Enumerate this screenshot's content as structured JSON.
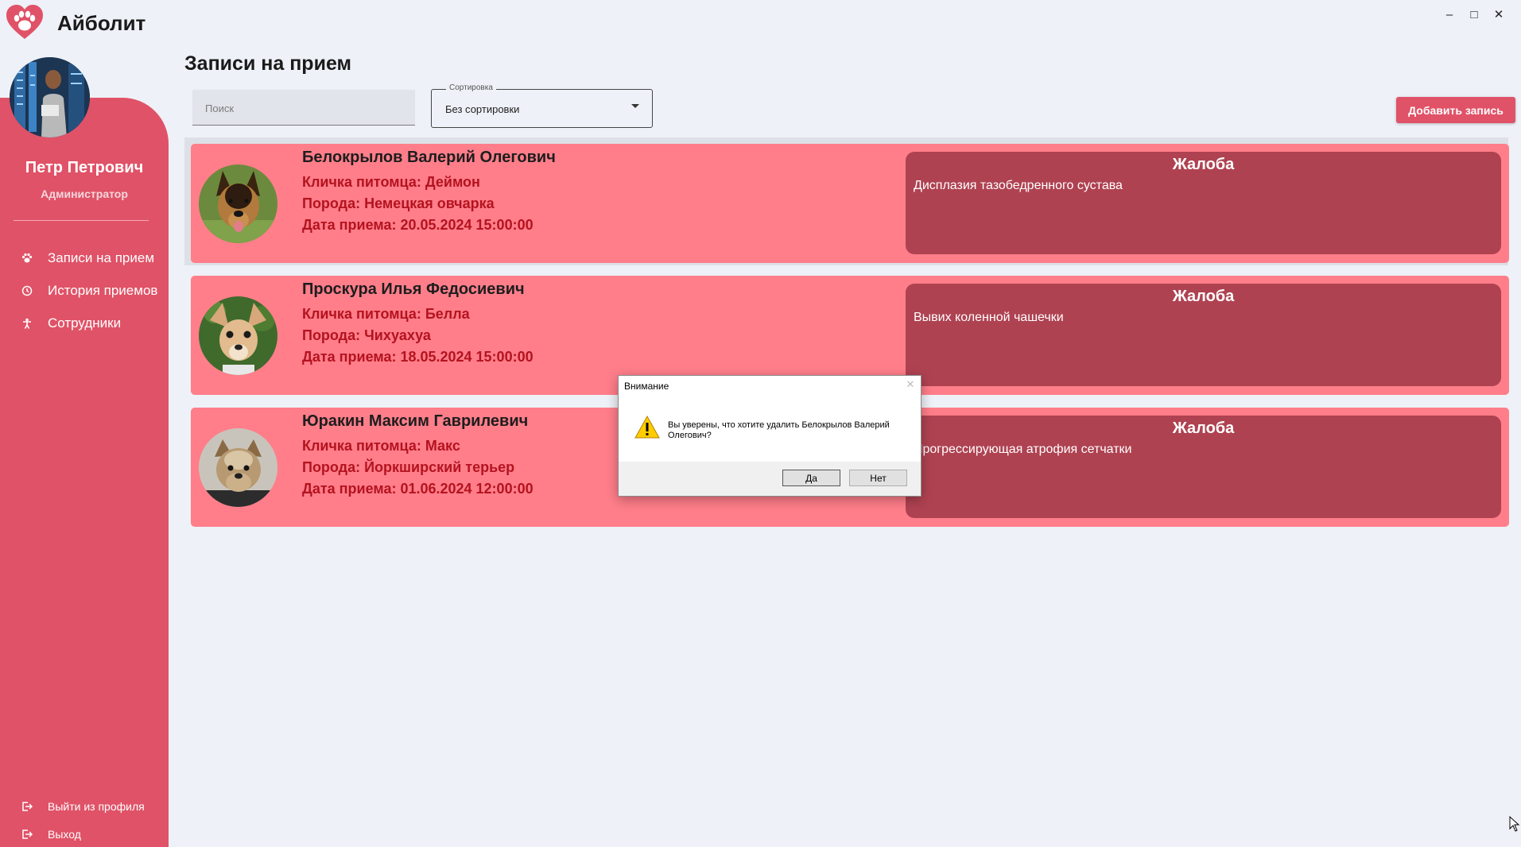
{
  "app": {
    "title": "Айболит",
    "window_controls": {
      "minimize": "–",
      "maximize": "□",
      "close": "✕"
    },
    "logo_icon": "paw-heart-logo-icon",
    "brand_color": "#e05267"
  },
  "sidebar": {
    "user_name": "Петр Петрович",
    "user_role": "Администратор",
    "nav": [
      {
        "label": "Записи на прием",
        "icon": "paw-icon"
      },
      {
        "label": "История приемов",
        "icon": "history-icon"
      },
      {
        "label": "Сотрудники",
        "icon": "person-icon"
      }
    ],
    "bottom": [
      {
        "label": "Выйти из профиля",
        "icon": "logout-icon"
      },
      {
        "label": "Выход",
        "icon": "exit-icon"
      }
    ]
  },
  "main": {
    "title": "Записи на прием",
    "search_placeholder": "Поиск",
    "sort_label": "Сортировка",
    "sort_value": "Без сортировки",
    "add_button": "Добавить запись"
  },
  "appointments": [
    {
      "owner": "Белокрылов Валерий Олегович",
      "pet_name": "Кличка питомца: Деймон",
      "breed": "Порода: Немецкая овчарка",
      "date": "Дата приема: 20.05.2024 15:00:00",
      "complaint_title": "Жалоба",
      "complaint": "Дисплазия тазобедренного сустава"
    },
    {
      "owner": "Проскура Илья Федосиевич",
      "pet_name": "Кличка питомца: Белла",
      "breed": "Порода: Чихуахуа",
      "date": "Дата приема: 18.05.2024 15:00:00",
      "complaint_title": "Жалоба",
      "complaint": "Вывих коленной чашечки"
    },
    {
      "owner": "Юракин Максим Гаврилевич",
      "pet_name": "Кличка питомца: Макс",
      "breed": "Порода: Йоркширский терьер",
      "date": "Дата приема: 01.06.2024 12:00:00",
      "complaint_title": "Жалоба",
      "complaint": "Прогрессирующая атрофия сетчатки"
    }
  ],
  "dialog": {
    "title": "Внимание",
    "message": "Вы уверены, что хотите удалить Белокрылов Валерий Олегович?",
    "yes": "Да",
    "no": "Нет",
    "icon": "warning-icon"
  }
}
